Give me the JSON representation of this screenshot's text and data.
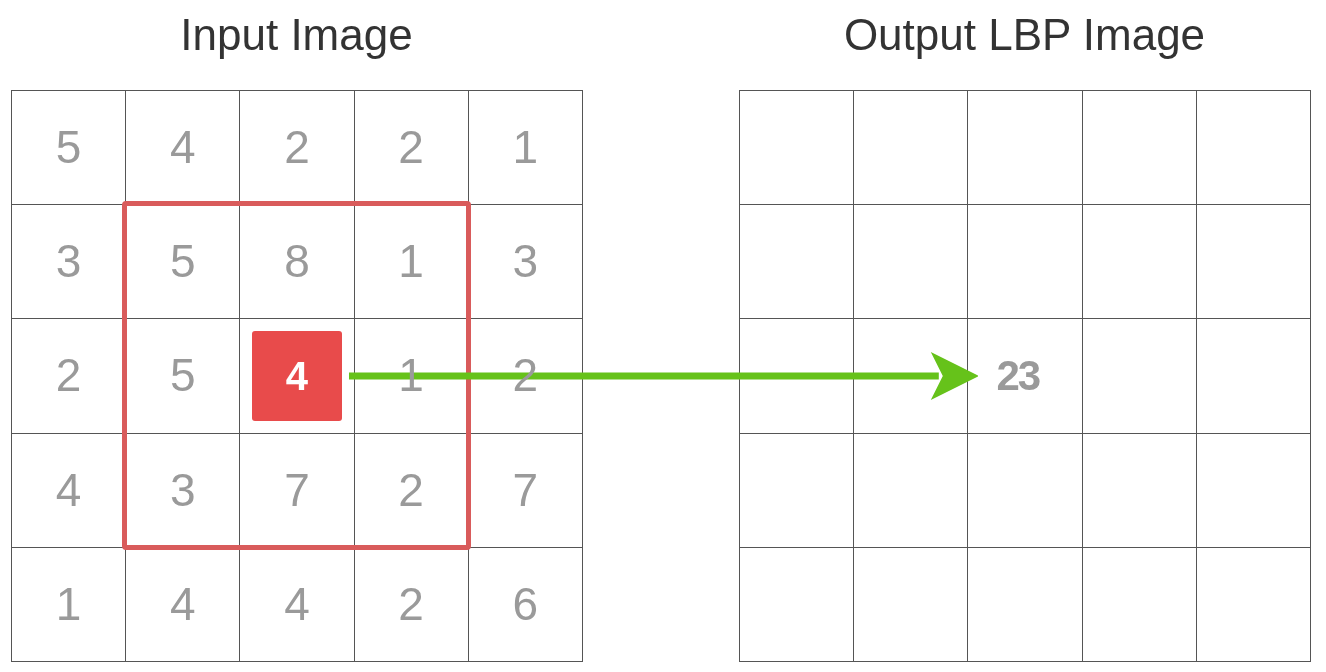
{
  "input_image": {
    "title": "Input Image",
    "rows": [
      [
        {
          "value": "5",
          "highlighted": false
        },
        {
          "value": "4",
          "highlighted": false
        },
        {
          "value": "2",
          "highlighted": false
        },
        {
          "value": "2",
          "highlighted": false
        },
        {
          "value": "1",
          "highlighted": false
        }
      ],
      [
        {
          "value": "3",
          "highlighted": false
        },
        {
          "value": "5",
          "highlighted": false
        },
        {
          "value": "8",
          "highlighted": false
        },
        {
          "value": "1",
          "highlighted": false
        },
        {
          "value": "3",
          "highlighted": false
        }
      ],
      [
        {
          "value": "2",
          "highlighted": false
        },
        {
          "value": "5",
          "highlighted": false
        },
        {
          "value": "4",
          "highlighted": true
        },
        {
          "value": "1",
          "highlighted": false
        },
        {
          "value": "2",
          "highlighted": false
        }
      ],
      [
        {
          "value": "4",
          "highlighted": false
        },
        {
          "value": "3",
          "highlighted": false
        },
        {
          "value": "7",
          "highlighted": false
        },
        {
          "value": "2",
          "highlighted": false
        },
        {
          "value": "7",
          "highlighted": false
        }
      ],
      [
        {
          "value": "1",
          "highlighted": false
        },
        {
          "value": "4",
          "highlighted": false
        },
        {
          "value": "4",
          "highlighted": false
        },
        {
          "value": "2",
          "highlighted": false
        },
        {
          "value": "6",
          "highlighted": false
        }
      ]
    ]
  },
  "output_image": {
    "title": "Output LBP Image",
    "result": "23"
  }
}
